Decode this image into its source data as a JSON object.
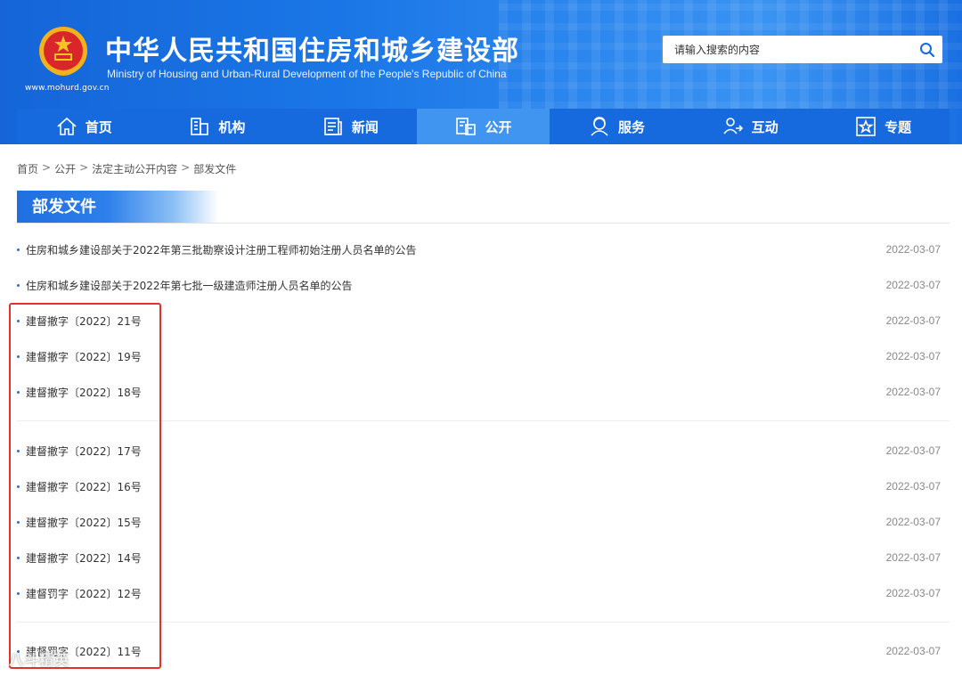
{
  "header": {
    "title_cn": "中华人民共和国住房和城乡建设部",
    "title_en": "Ministry of Housing and Urban-Rural Development of the People's Republic of China",
    "site_url": "www.mohurd.gov.cn",
    "search_placeholder": "请输入搜索的内容"
  },
  "nav": {
    "items": [
      {
        "label": "首页",
        "icon": "home-icon"
      },
      {
        "label": "机构",
        "icon": "building-icon"
      },
      {
        "label": "新闻",
        "icon": "news-icon"
      },
      {
        "label": "公开",
        "icon": "disclosure-icon",
        "active": true
      },
      {
        "label": "服务",
        "icon": "service-icon"
      },
      {
        "label": "互动",
        "icon": "interaction-icon"
      },
      {
        "label": "专题",
        "icon": "topic-icon"
      }
    ]
  },
  "breadcrumb": [
    "首页",
    "公开",
    "法定主动公开内容",
    "部发文件"
  ],
  "section_title": "部发文件",
  "list": [
    {
      "title": "住房和城乡建设部关于2022年第三批勘察设计注册工程师初始注册人员名单的公告",
      "date": "2022-03-07"
    },
    {
      "title": "住房和城乡建设部关于2022年第七批一级建造师注册人员名单的公告",
      "date": "2022-03-07"
    },
    {
      "title": "建督撤字〔2022〕21号",
      "date": "2022-03-07"
    },
    {
      "title": "建督撤字〔2022〕19号",
      "date": "2022-03-07"
    },
    {
      "title": "建督撤字〔2022〕18号",
      "date": "2022-03-07"
    },
    {
      "title": "建督撤字〔2022〕17号",
      "date": "2022-03-07"
    },
    {
      "title": "建督撤字〔2022〕16号",
      "date": "2022-03-07"
    },
    {
      "title": "建督撤字〔2022〕15号",
      "date": "2022-03-07"
    },
    {
      "title": "建督撤字〔2022〕14号",
      "date": "2022-03-07"
    },
    {
      "title": "建督罚字〔2022〕12号",
      "date": "2022-03-07"
    },
    {
      "title": "建督罚字〔2022〕11号",
      "date": "2022-03-07"
    }
  ],
  "watermark": "八斗精英",
  "colors": {
    "brand_blue": "#1769de",
    "nav_active": "#3f95f0",
    "annotation_red": "#e0312c"
  }
}
